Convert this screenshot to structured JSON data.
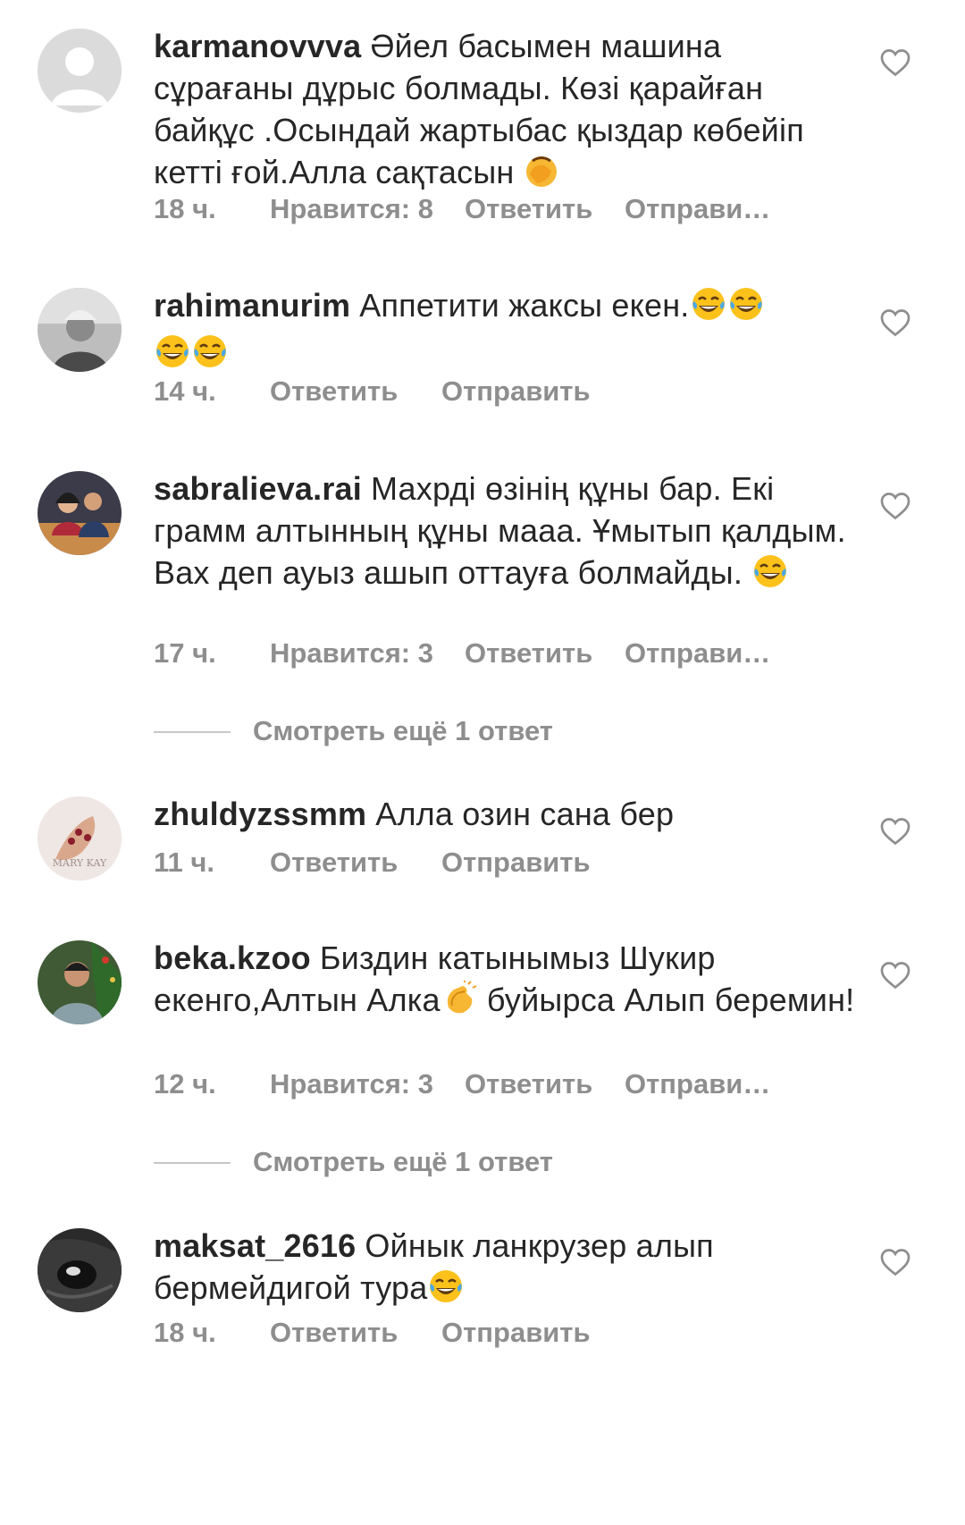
{
  "comments": [
    {
      "username": "karmanovvva",
      "text": "Әйел басымен машина сұрағаны дұрыс болмады. Көзі қарайған байқұс .Осындай жартыбас қыздар көбейіп кетті ғой.Алла сақтасын",
      "emoji": "face-palm-emoji",
      "time": "18 ч.",
      "likes": "Нравится: 8",
      "reply": "Ответить",
      "send": "Отправи…"
    },
    {
      "username": "rahimanurim",
      "text": "Аппетити жаксы екен.",
      "emoji": "tears-of-joy-emoji ×4",
      "time": "14 ч.",
      "reply": "Ответить",
      "send": "Отправить"
    },
    {
      "username": "sabralieva.rai",
      "text": "Махрді өзінің құны бар. Екі грамм алтынның құны мааа. Ұмытып қалдым. Вах деп ауыз ашып оттауға болмайды.",
      "emoji": "tears-of-joy-emoji",
      "time": "17 ч.",
      "likes": "Нравится: 3",
      "reply": "Ответить",
      "send": "Отправи…",
      "more_replies": "Смотреть ещё 1 ответ"
    },
    {
      "username": "zhuldyzssmm",
      "text": "Алла озин сана бер",
      "time": "11 ч.",
      "reply": "Ответить",
      "send": "Отправить",
      "avatar_text": "MARY KAY"
    },
    {
      "username": "beka.kzoo",
      "text_part1": "Биздин катынымыз Шукир екенго,Алтын Алка",
      "text_part2": "буйырса Алып беремин!",
      "emoji": "clapping-hands-emoji",
      "time": "12 ч.",
      "likes": "Нравится: 3",
      "reply": "Ответить",
      "send": "Отправи…",
      "more_replies": "Смотреть ещё 1 ответ"
    },
    {
      "username": "maksat_2616",
      "text": "Ойнык ланкрузер алып бермейдигой тура",
      "emoji": "tears-of-joy-emoji",
      "time": "18 ч.",
      "reply": "Ответить",
      "send": "Отправить"
    }
  ],
  "icons": {
    "like": "heart-outline-icon"
  },
  "colors": {
    "text": "#262626",
    "secondary": "#8e8e8e",
    "background": "#ffffff"
  }
}
